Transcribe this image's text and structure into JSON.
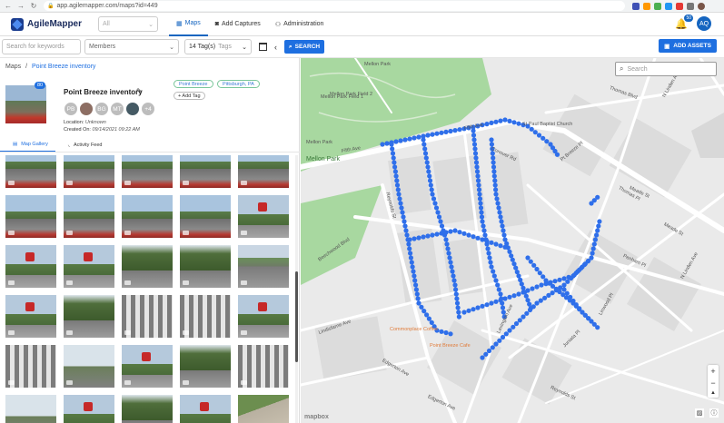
{
  "browser": {
    "url": "app.agilemapper.com/maps?id=449"
  },
  "app": {
    "name": "AgileMapper",
    "org_placeholder": "All",
    "nav": [
      {
        "label": "Maps",
        "icon": "map-icon"
      },
      {
        "label": "Add Captures",
        "icon": "camera-icon"
      },
      {
        "label": "Administration",
        "icon": "people-icon"
      }
    ],
    "notifications": "50",
    "user_initials": "AQ"
  },
  "filters": {
    "search_placeholder": "Search for keywords",
    "members_placeholder": "Members",
    "tags_count": "14 Tag(s)",
    "tags_placeholder": "Tags",
    "search_button": "SEARCH",
    "add_assets_button": "ADD ASSETS"
  },
  "panel": {
    "breadcrumb_root": "Maps",
    "breadcrumb_sep": "/",
    "breadcrumb_current": "Point Breeze inventory",
    "count": "80",
    "title": "Point Breeze inventory",
    "members": [
      "PB",
      "BG",
      "MT"
    ],
    "members_more": "+4",
    "location_label": "Location:",
    "location_value": "Unknown",
    "created_label": "Created On:",
    "created_value": "09/14/2021 09:22 AM",
    "tags": [
      "Point Breeze",
      "Pittsburgh, PA"
    ],
    "add_tag": "+ Add Tag",
    "tab_gallery": "Map Gallery",
    "tab_feed": "Activity Feed"
  },
  "map": {
    "search_placeholder": "Search",
    "attribution": "mapbox",
    "labels": {
      "fifth_ave_upper": "Fifth Ave",
      "fifth_ave_left": "Fifth Ave",
      "mellon_park": "Mellon Park",
      "mellon_park_top": "Mellon Park",
      "mellon_field1": "Mellon Park Field 1",
      "mellon_field2": "Mellon Park Field 2",
      "mellon_park_small": "Mellon Park",
      "church": "St Paul Baptist Church",
      "thomas": "Thomas Blvd",
      "linden": "N Linden Ave",
      "point_breeze_pl": "Pt Breeze Pl",
      "conover": "Conover Rd",
      "reynolds_st": "Reynolds St",
      "reynolds_st2": "Reynolds St",
      "beechwood": "Beechwood Blvd",
      "meade": "Meade St",
      "penham": "Penham Pl",
      "lexington": "Lexington Ave",
      "edgerton": "Edgerton Ave",
      "edgerton2": "Edgerton Ave",
      "linden2": "N Linden Ave",
      "lindisfarne": "Lindisfarne Ave",
      "point_breeze_cafe": "Point Breeze Cafe",
      "commonplace": "Commonplace Coffee",
      "juniata": "Juniata Pl",
      "linwood": "Linwood Pl",
      "thomas_pl": "Thomas Pl",
      "meade2": "Meade St"
    }
  }
}
